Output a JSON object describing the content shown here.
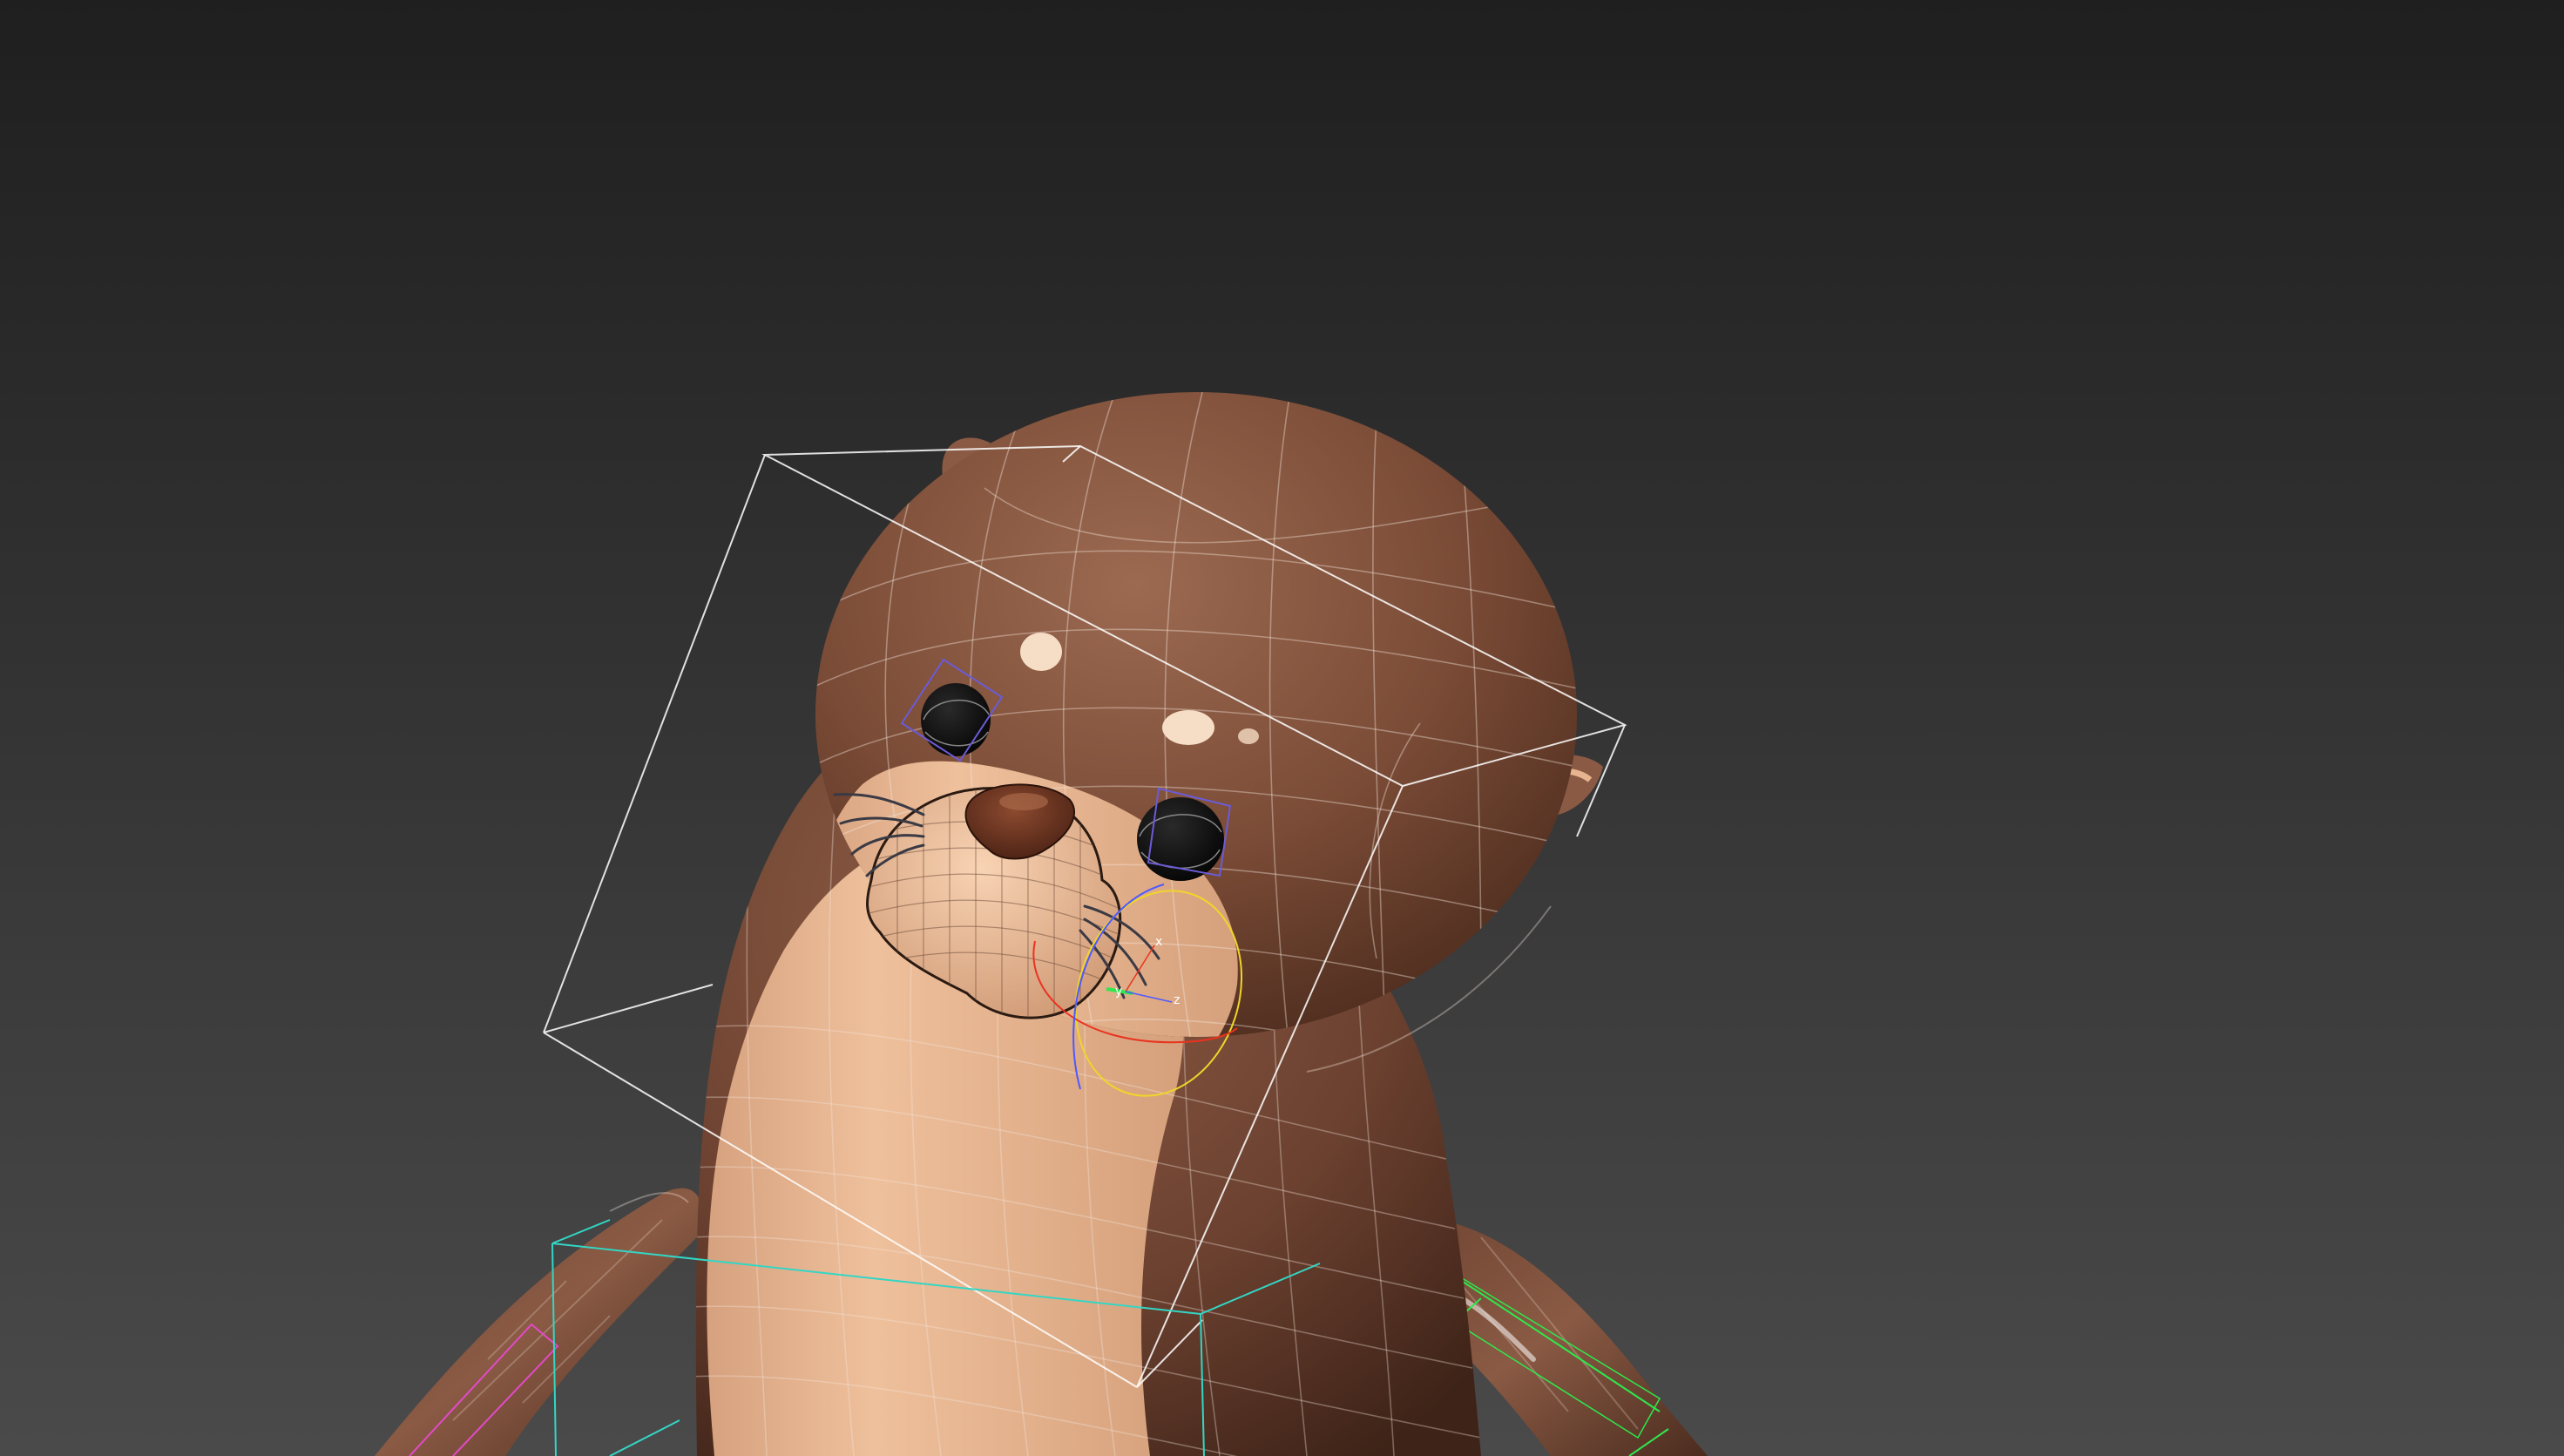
{
  "viewport": {
    "background_top": "#232323",
    "background_bottom": "#4a4a4a",
    "scene_subject": "otter",
    "fur_color": "#7a4b36",
    "belly_color": "#e7b48f",
    "wire_color": "#f3e6dc",
    "selection_box_color": "#ffffff",
    "bone_box_color": "#33d6c5",
    "ik_color": "#2ee84d",
    "arm_helper_color": "#e14ac8"
  },
  "gizmo": {
    "axes": [
      {
        "axis": "x",
        "label": "x",
        "color": "#e9331f"
      },
      {
        "axis": "y",
        "label": "y",
        "color": "#2ee84d"
      },
      {
        "axis": "z",
        "label": "z",
        "color": "#4d59ff"
      }
    ],
    "ring_color": "#f0d52a"
  }
}
